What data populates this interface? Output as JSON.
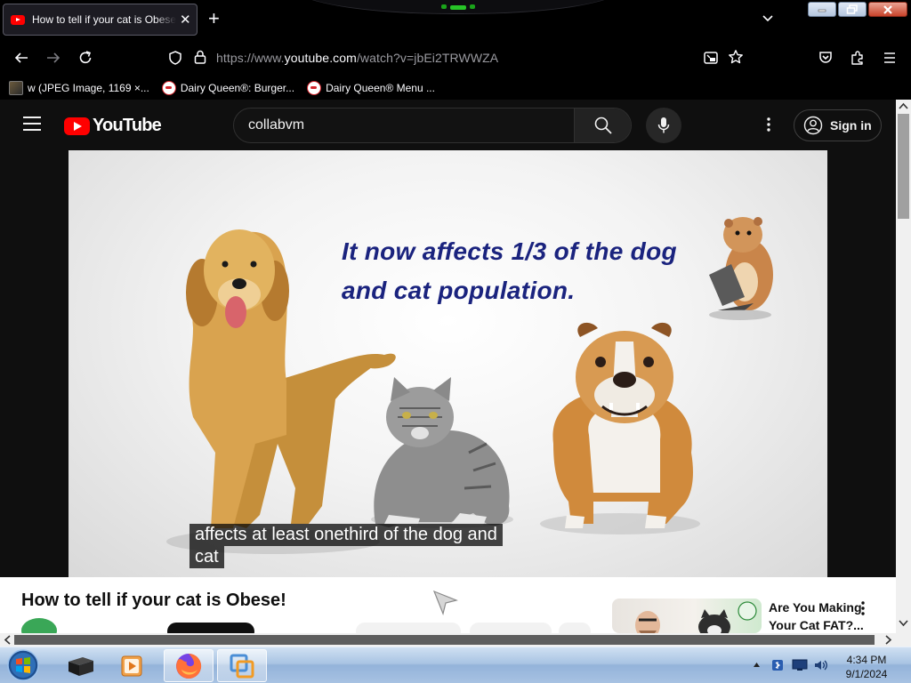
{
  "browser": {
    "tab": {
      "title": "How to tell if your cat is Obese!",
      "close": "✕"
    },
    "new_tab": "+",
    "url": {
      "scheme": "https://www.",
      "host": "youtube.com",
      "path": "/watch?v=jbEi2TRWWZA"
    },
    "bookmarks": [
      {
        "label": "w (JPEG Image, 1169 ×..."
      },
      {
        "label": "Dairy Queen®: Burger..."
      },
      {
        "label": "Dairy Queen® Menu ..."
      }
    ]
  },
  "youtube": {
    "logo": "YouTube",
    "search_query": "collabvm",
    "sign_in": "Sign in",
    "video": {
      "headline_line1": "It now affects 1/3 of the dog",
      "headline_line2": "and cat population.",
      "caption_line1": "affects at least onethird of the dog and",
      "caption_line2": "cat"
    },
    "title": "How to tell if your cat is Obese!",
    "recommendation": {
      "title": "Are You Making Your Cat FAT?..."
    }
  },
  "taskbar": {
    "time": "4:34 PM",
    "date": "9/1/2024"
  },
  "colors": {
    "yt_red": "#ff0000",
    "headline": "#1a237e",
    "taskbar": "#a9c4e3"
  }
}
